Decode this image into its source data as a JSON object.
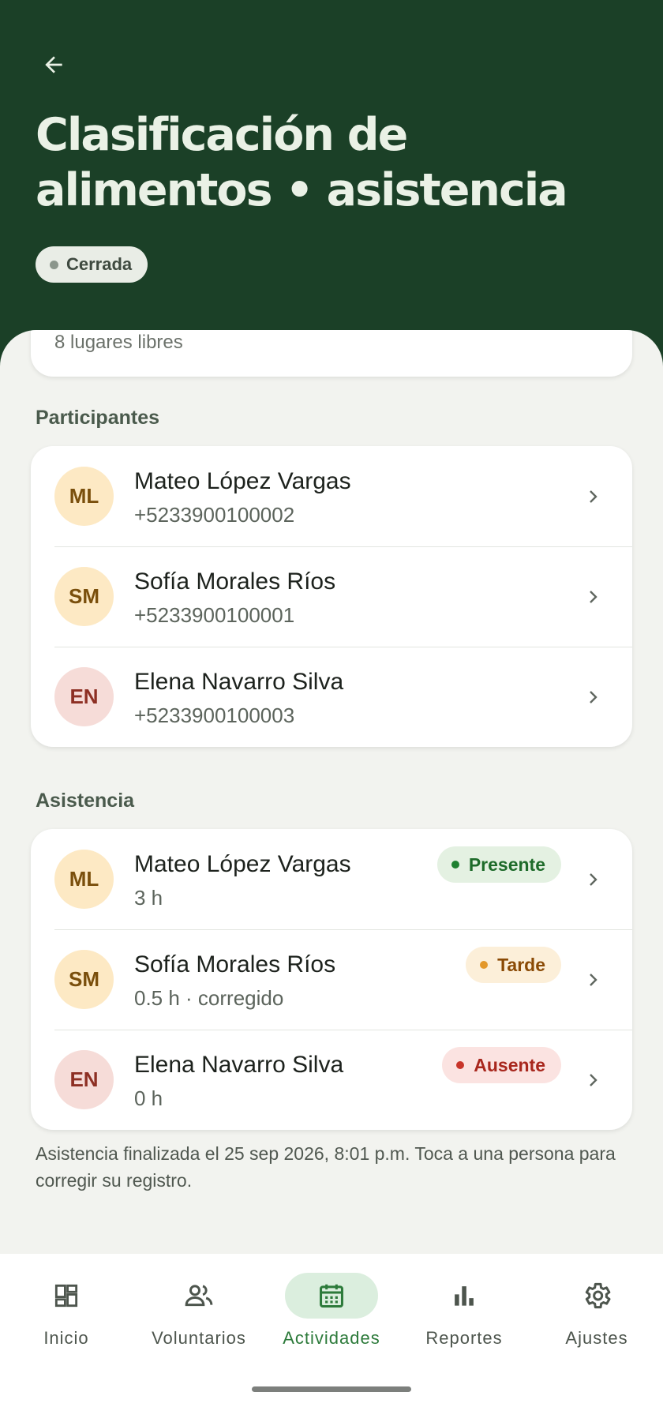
{
  "header": {
    "title": "Clasificación de alimentos • asistencia",
    "status": "Cerrada"
  },
  "previous_card": {
    "text": "8 lugares libres"
  },
  "participants": {
    "label": "Participantes",
    "items": [
      {
        "initials": "ML",
        "name": "Mateo López Vargas",
        "phone": "+5233900100002"
      },
      {
        "initials": "SM",
        "name": "Sofía Morales Ríos",
        "phone": "+5233900100001"
      },
      {
        "initials": "EN",
        "name": "Elena Navarro Silva",
        "phone": "+5233900100003"
      }
    ]
  },
  "attendance": {
    "label": "Asistencia",
    "items": [
      {
        "initials": "ML",
        "name": "Mateo López Vargas",
        "detail": "3 h",
        "status": "Presente"
      },
      {
        "initials": "SM",
        "name": "Sofía Morales Ríos",
        "detail": "0.5 h · corregido",
        "status": "Tarde"
      },
      {
        "initials": "EN",
        "name": "Elena Navarro Silva",
        "detail": "0 h",
        "status": "Ausente"
      }
    ],
    "footnote": "Asistencia finalizada el 25 sep 2026, 8:01 p.m. Toca a una persona para corregir su registro."
  },
  "nav": {
    "items": [
      {
        "label": "Inicio",
        "icon": "dashboard-icon"
      },
      {
        "label": "Voluntarios",
        "icon": "people-icon"
      },
      {
        "label": "Actividades",
        "icon": "calendar-icon",
        "active": true
      },
      {
        "label": "Reportes",
        "icon": "bar-chart-icon"
      },
      {
        "label": "Ajustes",
        "icon": "gear-icon"
      }
    ]
  },
  "colors": {
    "header_bg": "#1b4027",
    "accent": "#2c7a3a",
    "present": "#1e8030",
    "late": "#e3982a",
    "absent": "#c8352a"
  }
}
